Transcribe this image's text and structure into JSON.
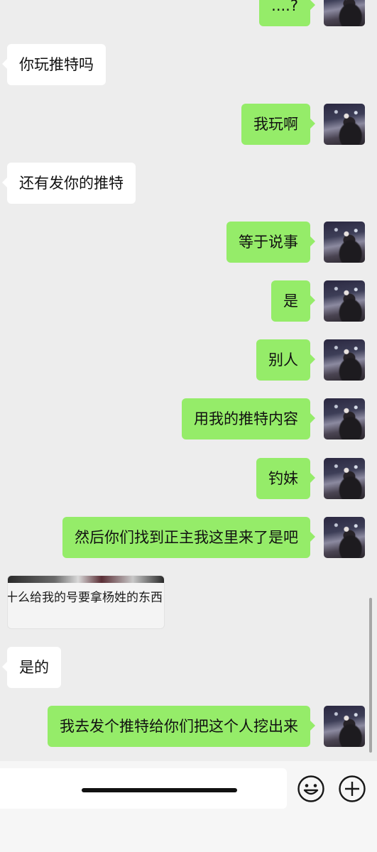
{
  "messages": [
    {
      "side": "out",
      "text": "....?"
    },
    {
      "side": "in",
      "text": "你玩推特吗"
    },
    {
      "side": "out",
      "text": "我玩啊"
    },
    {
      "side": "in",
      "text": "还有发你的推特"
    },
    {
      "side": "out",
      "text": "等于说事"
    },
    {
      "side": "out",
      "text": "是"
    },
    {
      "side": "out",
      "text": "别人"
    },
    {
      "side": "out",
      "text": "用我的推特内容"
    },
    {
      "side": "out",
      "text": "钓妹"
    },
    {
      "side": "out",
      "text": "然后你们找到正主我这里来了是吧"
    },
    {
      "side": "in",
      "text": "是的"
    },
    {
      "side": "out",
      "text": "我去发个推特给你们把这个人挖出来"
    }
  ],
  "shared_card": {
    "text": "十么给我的号要拿杨姓的东西"
  },
  "input_bar": {
    "value": "",
    "emoji_icon": "smiley-face-icon",
    "more_icon": "plus-circle-icon"
  },
  "colors": {
    "background": "#ededed",
    "outgoing_bubble": "#95ec69",
    "incoming_bubble": "#ffffff"
  }
}
